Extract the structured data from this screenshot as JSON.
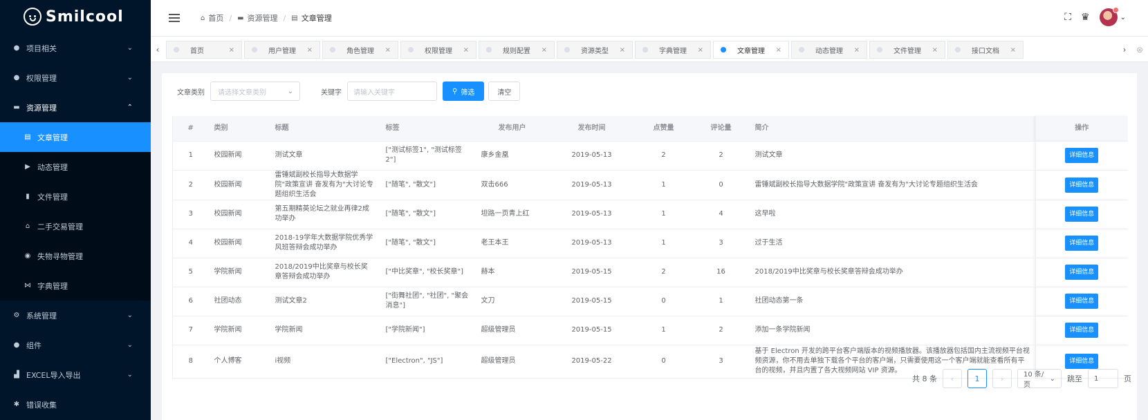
{
  "app": {
    "logo_text": "Smilcool"
  },
  "sidebar": {
    "items": [
      {
        "label": "项目相关",
        "icon": "project-icon",
        "glyph": "●",
        "arrow": "⌄"
      },
      {
        "label": "权限管理",
        "icon": "lock-icon",
        "glyph": "●",
        "arrow": "⌄"
      },
      {
        "label": "资源管理",
        "icon": "folder-icon",
        "glyph": "▬",
        "arrow": "⌃"
      }
    ],
    "submenu": [
      {
        "label": "文章管理",
        "icon": "article-icon",
        "glyph": "▤",
        "active": true
      },
      {
        "label": "动态管理",
        "icon": "play-icon",
        "glyph": "▶"
      },
      {
        "label": "文件管理",
        "icon": "file-icon",
        "glyph": "▮"
      },
      {
        "label": "二手交易管理",
        "icon": "home-icon",
        "glyph": "⌂"
      },
      {
        "label": "失物寻物管理",
        "icon": "eye-icon",
        "glyph": "◉"
      },
      {
        "label": "字典管理",
        "icon": "dict-icon",
        "glyph": "⋈"
      }
    ],
    "bottom_items": [
      {
        "label": "系统管理",
        "icon": "gear-icon",
        "glyph": "⚙",
        "arrow": "⌄"
      },
      {
        "label": "组件",
        "icon": "component-icon",
        "glyph": "●",
        "arrow": "⌄"
      },
      {
        "label": "EXCEL导入导出",
        "icon": "chart-icon",
        "glyph": "▟",
        "arrow": "⌄"
      },
      {
        "label": "错误收集",
        "icon": "bug-icon",
        "glyph": "✱",
        "arrow": ""
      }
    ]
  },
  "breadcrumb": [
    {
      "label": "首页",
      "glyph": "⌂"
    },
    {
      "label": "资源管理",
      "glyph": "▬"
    },
    {
      "label": "文章管理",
      "glyph": "▤"
    }
  ],
  "header": {
    "fullscreen_glyph": "⛶",
    "notify_glyph": "♛",
    "dropdown_glyph": "⌄"
  },
  "tabs": {
    "items": [
      "首页",
      "用户管理",
      "角色管理",
      "权限管理",
      "规则配置",
      "资源类型",
      "字典管理",
      "文章管理",
      "动态管理",
      "文件管理",
      "接口文档"
    ],
    "active": "文章管理",
    "close_glyph": "×",
    "prev_glyph": "‹",
    "next_glyph": "›",
    "close_all_glyph": "⊗"
  },
  "filter": {
    "category_label": "文章类别",
    "category_placeholder": "请选择文章类别",
    "keyword_label": "关键字",
    "keyword_placeholder": "请输入关键字",
    "search_button": "筛选",
    "search_glyph": "⚲",
    "clear_button": "清空"
  },
  "table": {
    "headers": [
      "#",
      "类别",
      "标题",
      "标签",
      "发布用户",
      "发布时间",
      "点赞量",
      "评论量",
      "简介",
      "操作"
    ],
    "detail_label": "详细信息",
    "rows": [
      {
        "idx": "1",
        "category": "校园新闻",
        "title": "测试文章",
        "tags": "[\"测试标签1\", \"测试标签2\"]",
        "user": "康乡金凰",
        "time": "2019-05-13",
        "likes": "2",
        "comments": "2",
        "intro": "测试文章"
      },
      {
        "idx": "2",
        "category": "校园新闻",
        "title": "雷锤斌副校长指导大数据学院\"政策宣讲 奋发有为\"大讨论专题组织生活会",
        "tags": "[\"随笔\", \"散文\"]",
        "user": "双击666",
        "time": "2019-05-13",
        "likes": "1",
        "comments": "0",
        "intro": "雷锤斌副校长指导大数据学院\"政策宣讲 奋发有为\"大讨论专题组织生活会"
      },
      {
        "idx": "3",
        "category": "校园新闻",
        "title": "第五期精英论坛之就业再律2成功举办",
        "tags": "[\"随笔\", \"散文\"]",
        "user": "坦路一页青上红",
        "time": "2019-05-13",
        "likes": "1",
        "comments": "4",
        "intro": "这早啦"
      },
      {
        "idx": "4",
        "category": "校园新闻",
        "title": "2018-19学年大数据学院优秀学风班答辩会成功举办",
        "tags": "[\"随笔\", \"散文\"]",
        "user": "老王本王",
        "time": "2019-05-13",
        "likes": "1",
        "comments": "3",
        "intro": "过于生活"
      },
      {
        "idx": "5",
        "category": "学院新闻",
        "title": "2018/2019中比奖章与校长奖章答辩会成功举办",
        "tags": "[\"中比奖章\", \"校长奖章\"]",
        "user": "赫本",
        "time": "2019-05-15",
        "likes": "2",
        "comments": "16",
        "intro": "2018/2019中比奖章与校长奖章答辩会成功举办"
      },
      {
        "idx": "6",
        "category": "社团动态",
        "title": "测试文章2",
        "tags": "[\"街舞社团\", \"社团\", \"聚会消息\"]",
        "user": "文刀",
        "time": "2019-05-15",
        "likes": "0",
        "comments": "1",
        "intro": "社团动态第一条"
      },
      {
        "idx": "7",
        "category": "学院新闻",
        "title": "学院新闻",
        "tags": "[\"学院新闻\"]",
        "user": "超级管理员",
        "time": "2019-05-15",
        "likes": "1",
        "comments": "2",
        "intro": "添加一条学院新闻"
      },
      {
        "idx": "8",
        "category": "个人博客",
        "title": "i视频",
        "tags": "[\"Electron\", \"JS\"]",
        "user": "超级管理员",
        "time": "2019-05-22",
        "likes": "0",
        "comments": "3",
        "intro": "基于 Electron 开发的跨平台客户端版本的视频播放器。该播放器包括国内主流视频平台视频资源，你不用去单独下载各个平台的客户端，只需要使用这一个客户端就能查看所有平台的视频，并且内置了各大视频网站 VIP 资源。"
      }
    ]
  },
  "pagination": {
    "total": "共 8 条",
    "prev_glyph": "‹",
    "next_glyph": "›",
    "current_page": "1",
    "page_size": "10 条/页",
    "jump_label": "跳至",
    "jump_value": "1",
    "page_unit": "页"
  }
}
